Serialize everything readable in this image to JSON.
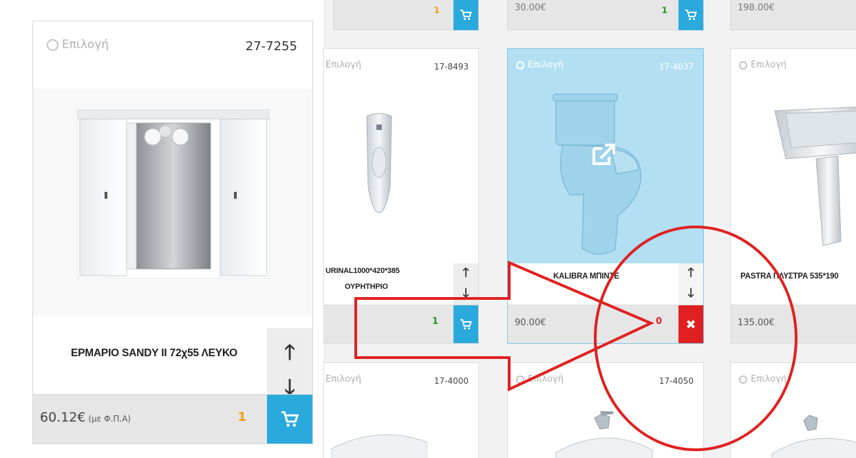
{
  "pick_label": "Επιλογή",
  "big_product": {
    "code": "27-7255",
    "name": "ΕΡΜΑΡΙΟ SANDY II 72χ55 ΛΕΥΚΟ",
    "price": "60.12€",
    "price_note": "(με Φ.Π.Α)",
    "qty": "1"
  },
  "top_row": [
    {
      "price": "",
      "qty": "1"
    },
    {
      "price": "30.00€",
      "qty": "1"
    },
    {
      "price": "198.00€",
      "qty": ""
    }
  ],
  "products": [
    {
      "code": "17-8493",
      "name_line1": "URINAL1000*420*385",
      "name_line2": "ΟΥΡΗΤΗΡΙΟ",
      "price": "",
      "qty": "1"
    },
    {
      "code": "17-4037",
      "name_line1": "KALIBRA ΜΠΙΝΤΕ",
      "price": "90.00€",
      "qty": "0",
      "selected": true
    },
    {
      "code": "",
      "name_line1": "PASTRA ΠΛΥΣΤΡΑ 535*190",
      "price": "135.00€"
    },
    {
      "code": "17-4000"
    },
    {
      "code": "17-4050"
    },
    {
      "code": ""
    }
  ],
  "colors": {
    "accent_blue": "#2aa9dd",
    "selected_bg": "#b3dff2",
    "remove_red": "#e02020",
    "annotation_red": "#e02020",
    "qty_green": "#1e9b1e",
    "qty_orange": "#f0a000"
  },
  "icons": [
    "radio-circle-icon",
    "cart-icon",
    "arrow-up-icon",
    "arrow-down-icon",
    "close-icon",
    "external-link-icon"
  ]
}
